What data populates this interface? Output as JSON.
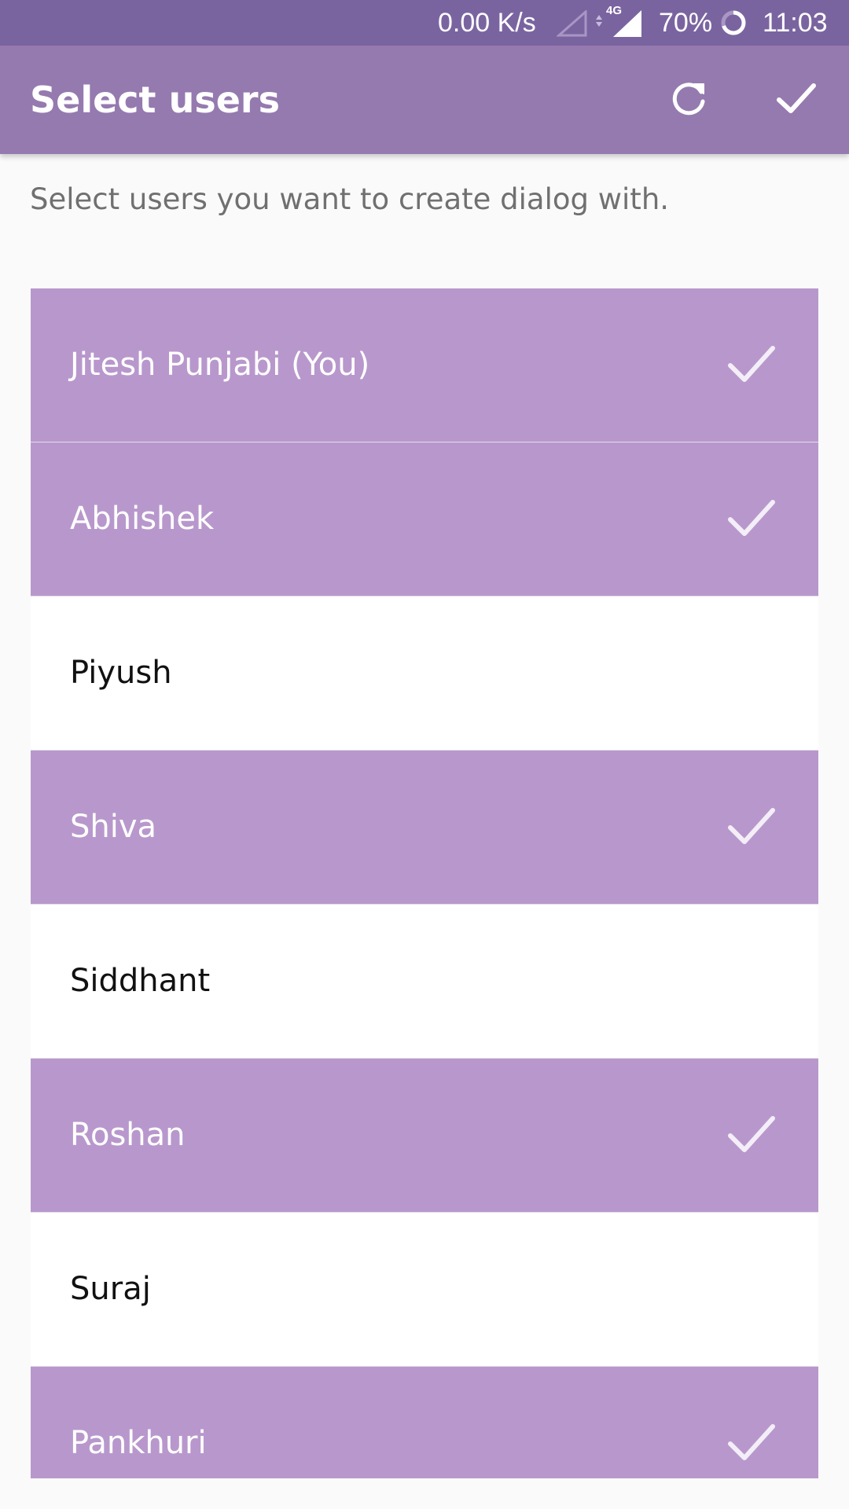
{
  "status_bar": {
    "network_speed": "0.00 K/s",
    "network_type": "4G",
    "battery": "70%",
    "time": "11:03"
  },
  "app_bar": {
    "title": "Select users",
    "refresh_icon": "refresh-icon",
    "confirm_icon": "check-icon"
  },
  "subtitle": "Select users you want to create dialog with.",
  "colors": {
    "status_bar": "#7a64a0",
    "app_bar": "#957aaf",
    "selected_row": "#b898cc",
    "background": "#fafafa"
  },
  "users": [
    {
      "name": "Jitesh Punjabi (You)",
      "selected": true
    },
    {
      "name": "Abhishek",
      "selected": true
    },
    {
      "name": "Piyush",
      "selected": false
    },
    {
      "name": "Shiva",
      "selected": true
    },
    {
      "name": "Siddhant",
      "selected": false
    },
    {
      "name": "Roshan",
      "selected": true
    },
    {
      "name": "Suraj",
      "selected": false
    },
    {
      "name": "Pankhuri",
      "selected": true
    }
  ]
}
